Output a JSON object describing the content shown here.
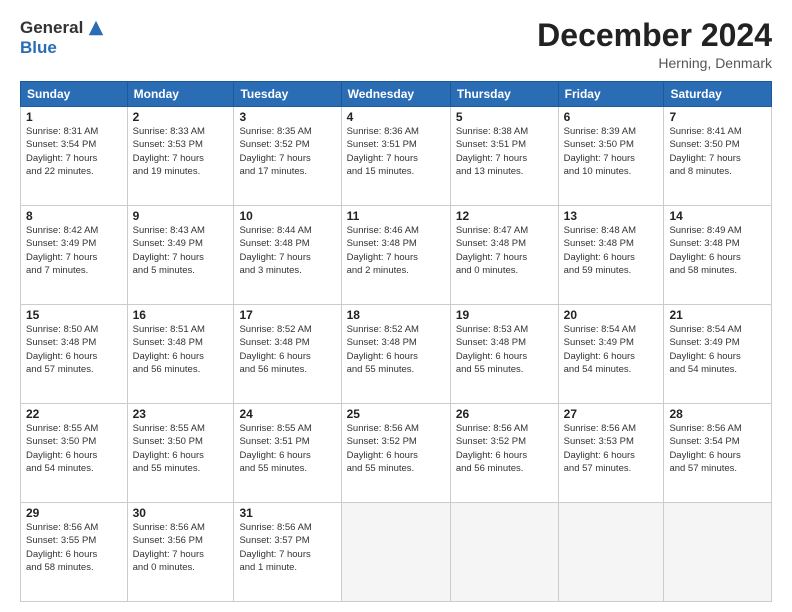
{
  "header": {
    "logo_general": "General",
    "logo_blue": "Blue",
    "month_title": "December 2024",
    "location": "Herning, Denmark"
  },
  "weekdays": [
    "Sunday",
    "Monday",
    "Tuesday",
    "Wednesday",
    "Thursday",
    "Friday",
    "Saturday"
  ],
  "weeks": [
    [
      {
        "day": "1",
        "info": "Sunrise: 8:31 AM\nSunset: 3:54 PM\nDaylight: 7 hours\nand 22 minutes."
      },
      {
        "day": "2",
        "info": "Sunrise: 8:33 AM\nSunset: 3:53 PM\nDaylight: 7 hours\nand 19 minutes."
      },
      {
        "day": "3",
        "info": "Sunrise: 8:35 AM\nSunset: 3:52 PM\nDaylight: 7 hours\nand 17 minutes."
      },
      {
        "day": "4",
        "info": "Sunrise: 8:36 AM\nSunset: 3:51 PM\nDaylight: 7 hours\nand 15 minutes."
      },
      {
        "day": "5",
        "info": "Sunrise: 8:38 AM\nSunset: 3:51 PM\nDaylight: 7 hours\nand 13 minutes."
      },
      {
        "day": "6",
        "info": "Sunrise: 8:39 AM\nSunset: 3:50 PM\nDaylight: 7 hours\nand 10 minutes."
      },
      {
        "day": "7",
        "info": "Sunrise: 8:41 AM\nSunset: 3:50 PM\nDaylight: 7 hours\nand 8 minutes."
      }
    ],
    [
      {
        "day": "8",
        "info": "Sunrise: 8:42 AM\nSunset: 3:49 PM\nDaylight: 7 hours\nand 7 minutes."
      },
      {
        "day": "9",
        "info": "Sunrise: 8:43 AM\nSunset: 3:49 PM\nDaylight: 7 hours\nand 5 minutes."
      },
      {
        "day": "10",
        "info": "Sunrise: 8:44 AM\nSunset: 3:48 PM\nDaylight: 7 hours\nand 3 minutes."
      },
      {
        "day": "11",
        "info": "Sunrise: 8:46 AM\nSunset: 3:48 PM\nDaylight: 7 hours\nand 2 minutes."
      },
      {
        "day": "12",
        "info": "Sunrise: 8:47 AM\nSunset: 3:48 PM\nDaylight: 7 hours\nand 0 minutes."
      },
      {
        "day": "13",
        "info": "Sunrise: 8:48 AM\nSunset: 3:48 PM\nDaylight: 6 hours\nand 59 minutes."
      },
      {
        "day": "14",
        "info": "Sunrise: 8:49 AM\nSunset: 3:48 PM\nDaylight: 6 hours\nand 58 minutes."
      }
    ],
    [
      {
        "day": "15",
        "info": "Sunrise: 8:50 AM\nSunset: 3:48 PM\nDaylight: 6 hours\nand 57 minutes."
      },
      {
        "day": "16",
        "info": "Sunrise: 8:51 AM\nSunset: 3:48 PM\nDaylight: 6 hours\nand 56 minutes."
      },
      {
        "day": "17",
        "info": "Sunrise: 8:52 AM\nSunset: 3:48 PM\nDaylight: 6 hours\nand 56 minutes."
      },
      {
        "day": "18",
        "info": "Sunrise: 8:52 AM\nSunset: 3:48 PM\nDaylight: 6 hours\nand 55 minutes."
      },
      {
        "day": "19",
        "info": "Sunrise: 8:53 AM\nSunset: 3:48 PM\nDaylight: 6 hours\nand 55 minutes."
      },
      {
        "day": "20",
        "info": "Sunrise: 8:54 AM\nSunset: 3:49 PM\nDaylight: 6 hours\nand 54 minutes."
      },
      {
        "day": "21",
        "info": "Sunrise: 8:54 AM\nSunset: 3:49 PM\nDaylight: 6 hours\nand 54 minutes."
      }
    ],
    [
      {
        "day": "22",
        "info": "Sunrise: 8:55 AM\nSunset: 3:50 PM\nDaylight: 6 hours\nand 54 minutes."
      },
      {
        "day": "23",
        "info": "Sunrise: 8:55 AM\nSunset: 3:50 PM\nDaylight: 6 hours\nand 55 minutes."
      },
      {
        "day": "24",
        "info": "Sunrise: 8:55 AM\nSunset: 3:51 PM\nDaylight: 6 hours\nand 55 minutes."
      },
      {
        "day": "25",
        "info": "Sunrise: 8:56 AM\nSunset: 3:52 PM\nDaylight: 6 hours\nand 55 minutes."
      },
      {
        "day": "26",
        "info": "Sunrise: 8:56 AM\nSunset: 3:52 PM\nDaylight: 6 hours\nand 56 minutes."
      },
      {
        "day": "27",
        "info": "Sunrise: 8:56 AM\nSunset: 3:53 PM\nDaylight: 6 hours\nand 57 minutes."
      },
      {
        "day": "28",
        "info": "Sunrise: 8:56 AM\nSunset: 3:54 PM\nDaylight: 6 hours\nand 57 minutes."
      }
    ],
    [
      {
        "day": "29",
        "info": "Sunrise: 8:56 AM\nSunset: 3:55 PM\nDaylight: 6 hours\nand 58 minutes."
      },
      {
        "day": "30",
        "info": "Sunrise: 8:56 AM\nSunset: 3:56 PM\nDaylight: 7 hours\nand 0 minutes."
      },
      {
        "day": "31",
        "info": "Sunrise: 8:56 AM\nSunset: 3:57 PM\nDaylight: 7 hours\nand 1 minute."
      },
      null,
      null,
      null,
      null
    ]
  ]
}
